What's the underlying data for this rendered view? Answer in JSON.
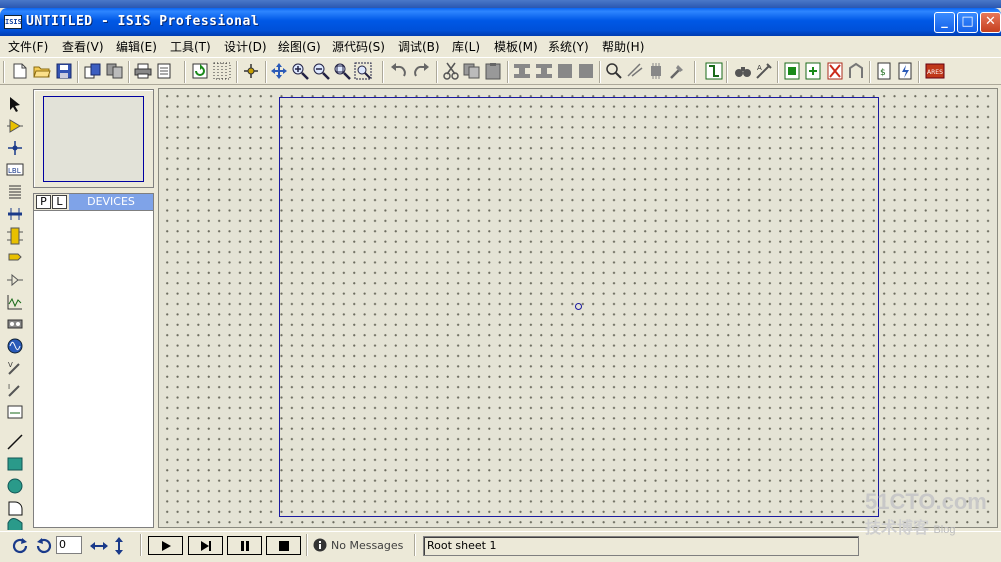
{
  "window": {
    "app_icon_label": "ISIS",
    "title": "UNTITLED - ISIS Professional",
    "minimize_label": "_",
    "maximize_label": "□",
    "close_label": "✕"
  },
  "menu": {
    "items": [
      {
        "label": "文件(F)"
      },
      {
        "label": "查看(V)"
      },
      {
        "label": "编辑(E)"
      },
      {
        "label": "工具(T)"
      },
      {
        "label": "设计(D)"
      },
      {
        "label": "绘图(G)"
      },
      {
        "label": "源代码(S)"
      },
      {
        "label": "调试(B)"
      },
      {
        "label": "库(L)"
      },
      {
        "label": "模板(M)"
      },
      {
        "label": "系统(Y)"
      },
      {
        "label": "帮助(H)"
      }
    ]
  },
  "toolbar": {
    "icons": [
      "new-file-icon",
      "open-folder-icon",
      "save-icon",
      "import-section-icon",
      "export-section-icon",
      "print-icon",
      "print-area-icon",
      "refresh-icon",
      "grid-icon",
      "origin-icon",
      "pan-icon",
      "zoom-in-icon",
      "zoom-out-icon",
      "zoom-all-icon",
      "zoom-area-icon",
      "undo-icon",
      "redo-icon",
      "cut-icon",
      "copy-icon",
      "paste-icon",
      "block-copy-icon",
      "block-move-icon",
      "block-rotate-icon",
      "block-delete-icon",
      "pick-device-icon",
      "make-device-icon",
      "packaging-icon",
      "decompose-icon",
      "wire-autorouter-icon",
      "search-tag-icon",
      "property-assignment-icon",
      "new-sheet-icon",
      "add-sheet-icon",
      "remove-sheet-icon",
      "goto-sheet-icon",
      "bill-of-materials-icon",
      "electrical-rules-check-icon",
      "ares-icon"
    ],
    "ares_label": "ARES"
  },
  "left_tools": {
    "icons": [
      "selection-mode-icon",
      "component-mode-icon",
      "junction-dot-icon",
      "wire-label-icon",
      "text-script-icon",
      "bus-icon",
      "subcircuit-icon",
      "terminals-icon",
      "device-pins-icon",
      "graph-mode-icon",
      "tape-recorder-icon",
      "generator-icon",
      "voltage-probe-icon",
      "current-probe-icon",
      "virtual-instruments-icon",
      "line-icon",
      "box-icon",
      "circle-icon",
      "arc-icon",
      "path-icon"
    ],
    "label_icon_text": "LBL"
  },
  "devices": {
    "p_label": "P",
    "l_label": "L",
    "title": "DEVICES",
    "items": []
  },
  "statusbar": {
    "rotate_cw_icon": "rotate-cw-icon",
    "rotate_ccw_icon": "rotate-ccw-icon",
    "angle_value": "0",
    "message": "No Messages",
    "sheet": "Root sheet 1"
  },
  "colors": {
    "titlebar": "#0058e6",
    "canvas_bg": "#e4e3d5",
    "sheet_border": "#1a1aa0",
    "devices_header": "#7fa3e8"
  },
  "watermark": {
    "line1": "51CTO.com",
    "line2": "技术博客",
    "line3": "Blog"
  }
}
